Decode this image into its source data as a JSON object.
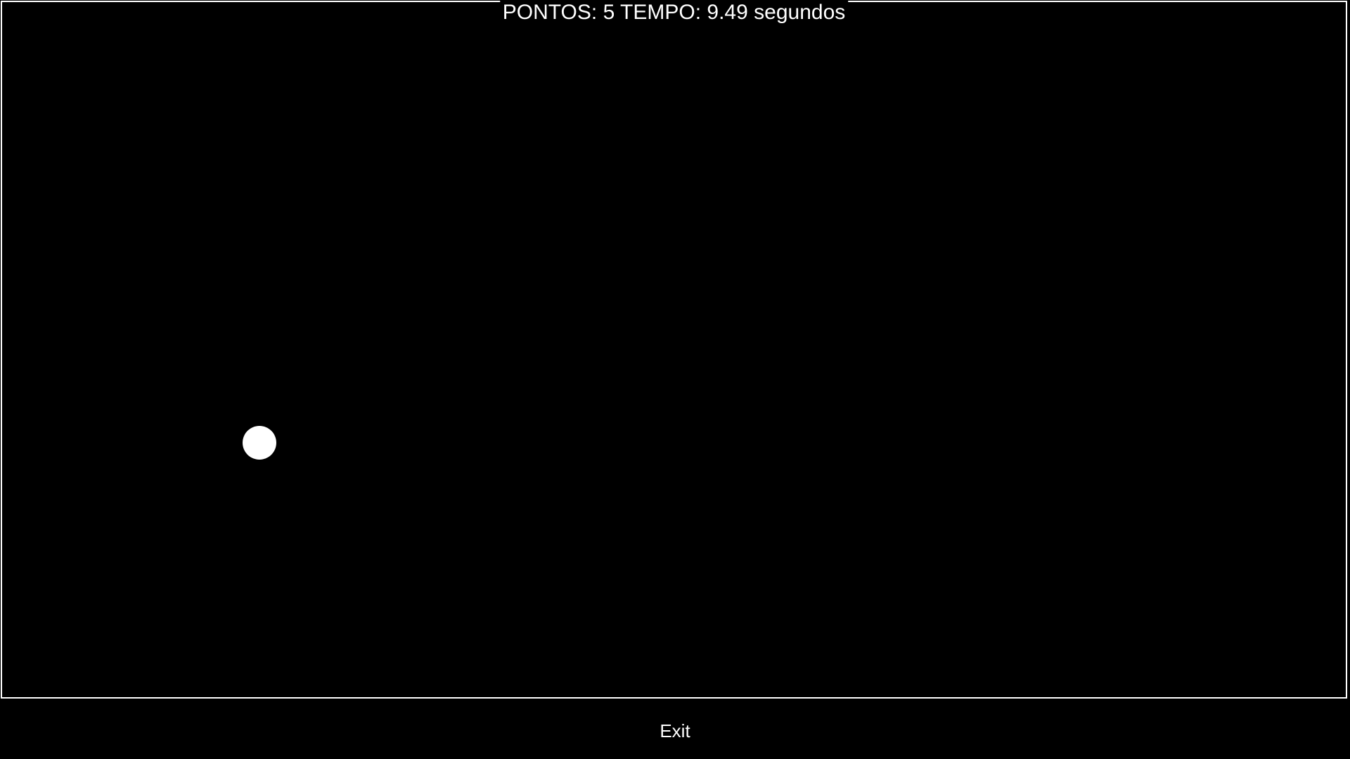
{
  "hud": {
    "points_label": "PONTOS:",
    "points_value": "5",
    "time_label": "TEMPO:",
    "time_value": "9.49",
    "time_unit": "segundos"
  },
  "footer": {
    "exit_label": "Exit"
  },
  "colors": {
    "background": "#000000",
    "foreground": "#ffffff"
  }
}
